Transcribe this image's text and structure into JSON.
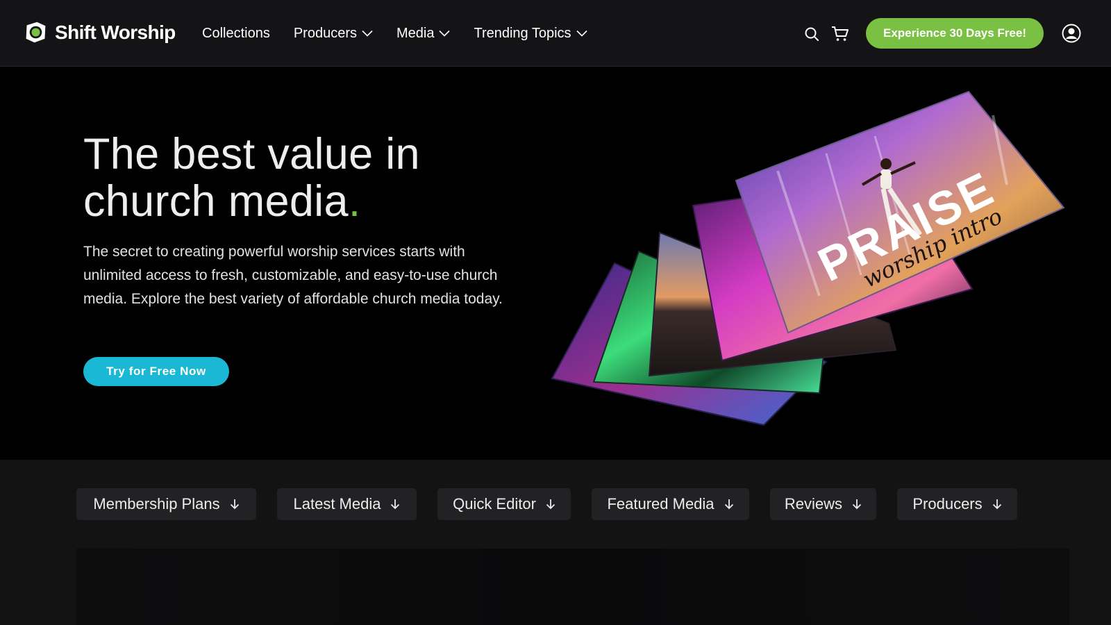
{
  "brand": {
    "name": "Shift Worship",
    "accent": "#7ac143"
  },
  "nav": {
    "items": [
      {
        "label": "Collections",
        "dropdown": false
      },
      {
        "label": "Producers",
        "dropdown": true
      },
      {
        "label": "Media",
        "dropdown": true
      },
      {
        "label": "Trending Topics",
        "dropdown": true
      }
    ]
  },
  "header": {
    "search_icon": "search-icon",
    "cart_icon": "cart-icon",
    "cta_label": "Experience 30 Days Free!",
    "account_icon": "user-circle-icon"
  },
  "hero": {
    "title_line1": "The best value in",
    "title_line2": "church media",
    "title_period": ".",
    "description": "The secret to creating powerful worship services starts with unlimited access to fresh, customizable, and easy-to-use church media. Explore the best variety of affordable church media today.",
    "cta_label": "Try for Free Now",
    "cta_color": "#1ab8d4",
    "card_title": "PRAISE",
    "card_subtitle": "worship intro"
  },
  "sections": {
    "items": [
      {
        "label": "Membership Plans"
      },
      {
        "label": "Latest Media"
      },
      {
        "label": "Quick Editor"
      },
      {
        "label": "Featured Media"
      },
      {
        "label": "Reviews"
      },
      {
        "label": "Producers"
      }
    ]
  }
}
